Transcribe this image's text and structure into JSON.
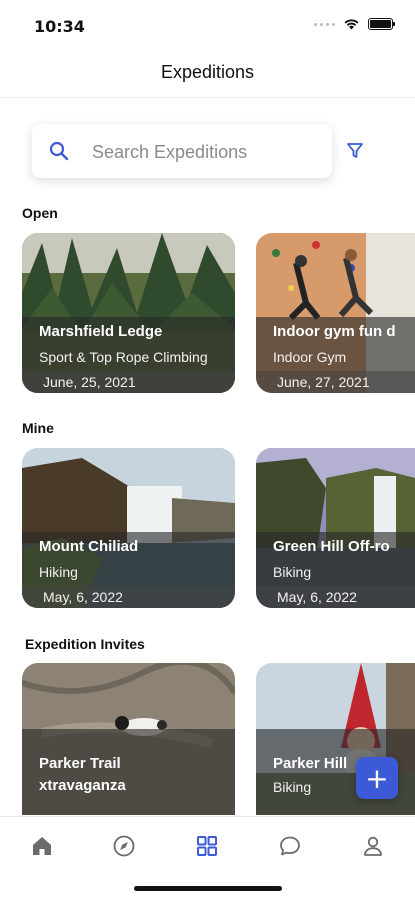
{
  "status_bar": {
    "time": "10:34"
  },
  "header": {
    "title": "Expeditions"
  },
  "search": {
    "placeholder": "Search Expeditions"
  },
  "sections": {
    "open": {
      "title": "Open",
      "cards": [
        {
          "title": "Marshfield Ledge",
          "subtitle": "Sport & Top Rope Climbing",
          "date": "June, 25, 2021"
        },
        {
          "title": "Indoor gym fun d",
          "subtitle": "Indoor Gym",
          "date": "June, 27, 2021"
        }
      ]
    },
    "mine": {
      "title": "Mine",
      "cards": [
        {
          "title": "Mount Chiliad",
          "subtitle": "Hiking",
          "date": "May, 6, 2022"
        },
        {
          "title": "Green Hill Off-ro",
          "subtitle": "Biking",
          "date": "May, 6, 2022"
        }
      ]
    },
    "invites": {
      "title": "Expedition Invites",
      "cards": [
        {
          "title": "Parker Trail xtravaganza",
          "subtitle": ""
        },
        {
          "title": "Parker Hill",
          "subtitle": "Biking"
        }
      ]
    }
  },
  "fab": {
    "label": "+"
  },
  "tabbar": {
    "items": [
      "home-icon",
      "compass-icon",
      "grid-icon",
      "chat-icon",
      "profile-icon"
    ],
    "active": "grid-icon"
  },
  "colors": {
    "accent": "#3d5ad6",
    "inactive_icon": "#6b6b6b"
  }
}
